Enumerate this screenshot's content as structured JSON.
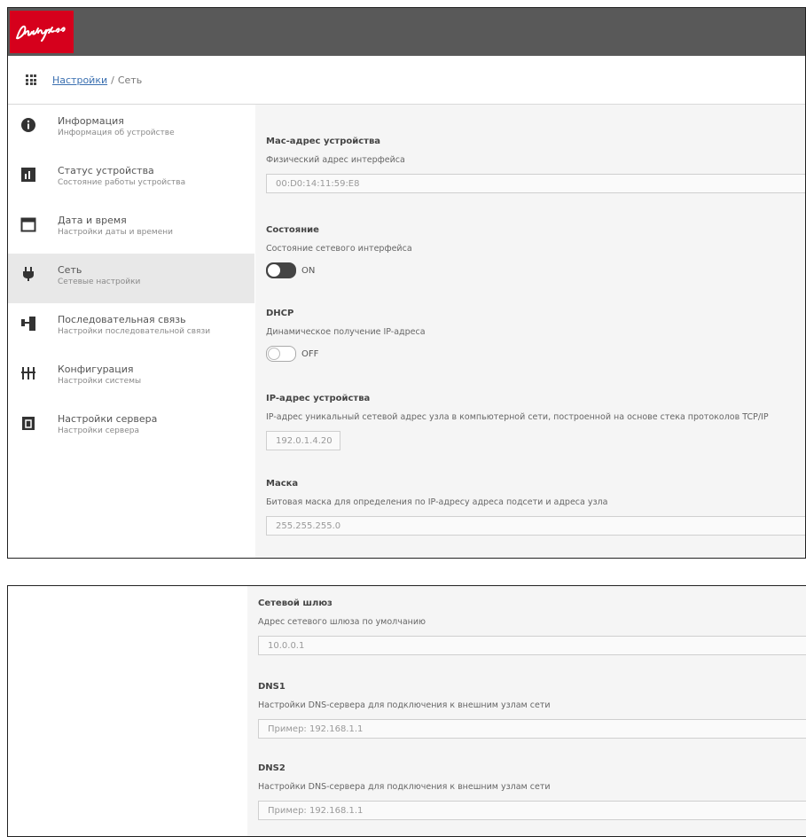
{
  "header": {
    "logo_text": "Danfoss",
    "brand_color": "#d6001c",
    "bar_color": "#595959"
  },
  "breadcrumb": {
    "link": "Настройки",
    "current": "Сеть"
  },
  "sidebar": {
    "items": [
      {
        "title": "Информация",
        "subtitle": "Информация об устройстве",
        "icon": "info-icon",
        "active": false
      },
      {
        "title": "Статус устройства",
        "subtitle": "Состояние работы устройства",
        "icon": "chart-icon",
        "active": false
      },
      {
        "title": "Дата и время",
        "subtitle": "Настройки даты и времени",
        "icon": "calendar-icon",
        "active": false
      },
      {
        "title": "Сеть",
        "subtitle": "Сетевые настройки",
        "icon": "plug-icon",
        "active": true
      },
      {
        "title": "Последовательная связь",
        "subtitle": "Настройки последовательной связи",
        "icon": "connection-icon",
        "active": false
      },
      {
        "title": "Конфигурация",
        "subtitle": "Настройки системы",
        "icon": "sliders-icon",
        "active": false
      },
      {
        "title": "Настройки сервера",
        "subtitle": "Настройки сервера",
        "icon": "server-icon",
        "active": false
      }
    ]
  },
  "network": {
    "mac": {
      "label": "Мас-адрес устройства",
      "description": "Физический адрес интерфейса",
      "value": "00:D0:14:11:59:E8"
    },
    "state": {
      "label": "Состояние",
      "description": "Состояние сетевого интерфейса",
      "toggle_label": "ON"
    },
    "dhcp": {
      "label": "DHCP",
      "description": "Динамическое получение IP-адреса",
      "toggle_label": "OFF"
    },
    "ip": {
      "label": "IP-адрес устройства",
      "description": "IP-адрес уникальный сетевой адрес узла в компьютерной сети, построенной на основе стека протоколов TCP/IP",
      "value": "192.0.1.4.20"
    },
    "mask": {
      "label": "Маска",
      "description": "Битовая маска для определения по IP-адресу адреса подсети и адреса узла",
      "value": "255.255.255.0"
    },
    "gateway": {
      "label": "Сетевой шлюз",
      "description": "Адрес сетевого шлюза по умолчанию",
      "value": "10.0.0.1"
    },
    "dns1": {
      "label": "DNS1",
      "description": "Настройки DNS-сервера для подключения к внешним узлам сети",
      "value": "Пример: 192.168.1.1"
    },
    "dns2": {
      "label": "DNS2",
      "description": "Настройки DNS-сервера для подключения к внешним узлам сети",
      "value": "Пример: 192.168.1.1"
    }
  }
}
